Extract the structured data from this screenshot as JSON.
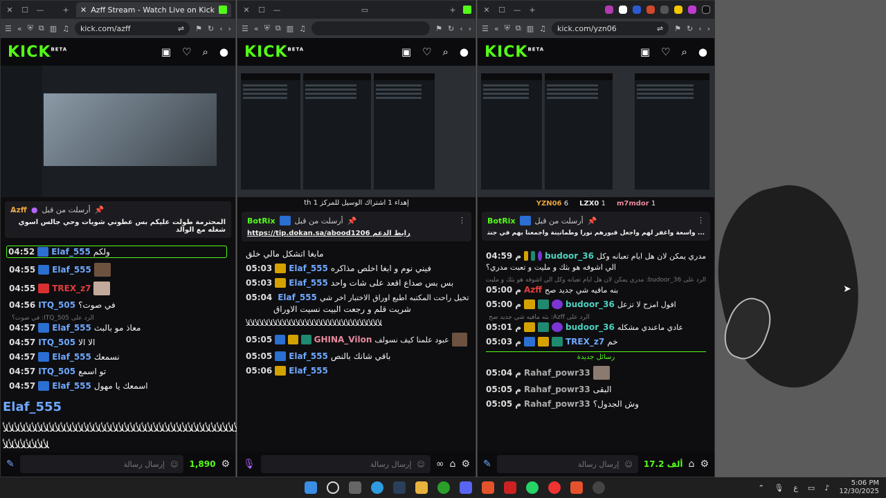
{
  "win1": {
    "tab_title": "Azff Stream - Watch Live on Kick",
    "url": "kick.com/azff",
    "pinned": {
      "from_label": "أرسلت من قبل",
      "from_user": "Azff",
      "message": "المحترمة طولت عليكم بس عطوني شويات وحي جالس اسوي شغله مع الوالد"
    },
    "chat": [
      {
        "time": "04:52",
        "user": "Elaf_555",
        "color": "#6fa8ff",
        "text": "ولكم"
      },
      {
        "time": "04:55",
        "user": "Elaf_555",
        "color": "#6fa8ff",
        "text": ""
      },
      {
        "time": "04:55",
        "user": "TREX_z7",
        "color": "#e63c3c",
        "text": ""
      },
      {
        "time": "04:56",
        "user": "ITQ_505",
        "color": "#6fa8ff",
        "text": "في صوت؟"
      },
      {
        "time": "04:57",
        "user": "Elaf_555",
        "color": "#6fa8ff",
        "text": "معاذ مو بالبث"
      },
      {
        "time": "04:57",
        "user": "ITQ_505",
        "color": "#6fa8ff",
        "text": "الا الا"
      },
      {
        "time": "04:57",
        "user": "Elaf_555",
        "color": "#6fa8ff",
        "text": "نسمعك"
      },
      {
        "time": "04:57",
        "user": "ITQ_505",
        "color": "#6fa8ff",
        "text": "تو اسمع"
      },
      {
        "time": "04:57",
        "user": "Elaf_555",
        "color": "#6fa8ff",
        "text": "اسمعك يا مهول"
      }
    ],
    "reply_1": "الرد على ITQ_505: في صوت؟",
    "overlay_name": "Elaf_555",
    "overlay_wave": "ﻸﻸﻸﻸﻸﻸﻸﻸﻸﻸﻸﻸﻸﻸﻸﻸﻸﻸﻸﻸﻸﻸﻸﻸﻸﻸﻸﻸﻸﻸﻸﻸﻸﻸﻸﻸﻸﻸﻸﻸﻸﻸﻸﻸﻸﻸ",
    "overlay_wave2": "ﻸﻸﻸﻸﻸﻸﻸﻸ",
    "input_placeholder": "إرسال رسالة",
    "points": "1,890"
  },
  "win2": {
    "url": "",
    "top_note": "إهداء 1 اشتراك الوسيل للمركز 1",
    "top_note_suffix": "th",
    "pinned": {
      "from_label": "أرسلت من قبل",
      "from_user": "BotRix",
      "message": "https://tip.dokan.sa/abood1206 رابط الدعم"
    },
    "chat": [
      {
        "time": "",
        "user": "",
        "color": "#6fa8ff",
        "text": "مابغا اتشكل مالي خلق"
      },
      {
        "time": "05:03",
        "user": "Elaf_555",
        "color": "#6fa8ff",
        "text": "فيني نوم و ابغا اخلص مذاكره"
      },
      {
        "time": "05:03",
        "user": "Elaf_555",
        "color": "#6fa8ff",
        "text": "بس بس صداع اقعد على شات واحد"
      },
      {
        "time": "05:04",
        "user": "Elaf_555",
        "color": "#6fa8ff",
        "text": "تخيل راحت المكتبه اطبع اوراق الاختبار اخر شي"
      },
      {
        "time": "05:05",
        "user": "Elaf_555",
        "color": "#6fa8ff",
        "text": "شريت قلم و رجعت البيت نسيت الاوراق"
      },
      {
        "time": "05:05",
        "user": "GHINA_Vilon",
        "color": "#e98aa0",
        "text": "عبود علمنا كيف نسولف"
      },
      {
        "time": "05:05",
        "user": "Elaf_555",
        "color": "#6fa8ff",
        "text": "باقي شانك بالنص"
      },
      {
        "time": "05:06",
        "user": "Elaf_555",
        "color": "#6fa8ff",
        "text": ""
      }
    ],
    "wave": "ﻸﻸﻸﻸﻸﻸﻸﻸﻸﻸﻸﻸﻸﻸﻸﻸﻸﻸﻸﻸﻸﻸﻸﻸﻸﻸﻸﻸﻸﻸ",
    "input_placeholder": "إرسال رسالة"
  },
  "win3": {
    "url": "kick.com/yzn06",
    "top_chatters": [
      {
        "name": "YZN06",
        "count": "6"
      },
      {
        "name": "LZX0",
        "count": "1"
      },
      {
        "name": "m7mdor",
        "count": "1"
      }
    ],
    "pinned": {
      "from_label": "أرسلت من قبل",
      "from_user": "BotRix",
      "message": "... واسعة واغفر لهم واجعل قبورهم نورا وطمأنينة واجمعنا بهم في جنتك بلا حساب ولا عقاب"
    },
    "chat": [
      {
        "time": "04:59",
        "user": "budoor_36",
        "color": "#4fd0c0",
        "text": "مدري يمكن لان هل ايام تعبانه وكل"
      },
      {
        "time": "",
        "user": "",
        "color": "#4fd0c0",
        "text": "الي اشوفه هو بثك و مليت و تعبت مدري؟"
      },
      {
        "time": "05:00",
        "user": "Azff",
        "color": "#e63c3c",
        "text": "بنه مافيه شي جديد صح"
      },
      {
        "time": "05:00",
        "user": "budoor_36",
        "color": "#4fd0c0",
        "text": "افول امزح لا تزعل"
      },
      {
        "time": "05:01",
        "user": "budoor_36",
        "color": "#4fd0c0",
        "text": "عادي ماعندي مشكله"
      },
      {
        "time": "05:03",
        "user": "TREX_z7",
        "color": "#6fa8ff",
        "text": "خم"
      }
    ],
    "reply_1": "الرد على budoor_36: مدري يمكن لان هل ايام تعبانه وكل الي اشوفه هو بثك و مليت و تعبت مدري؟",
    "reply_2": "الرد على Azff: بثه مافيه شي جديد صح",
    "new_messages": "رسائل جديدة",
    "chat_new": [
      {
        "time": "05:04",
        "user": "Rahaf_powr33",
        "color": "#aaaaaa",
        "text": ""
      },
      {
        "time": "05:05",
        "user": "Rahaf_powr33",
        "color": "#aaaaaa",
        "text": "البقى"
      },
      {
        "time": "05:05",
        "user": "Rahaf_powr33",
        "color": "#aaaaaa",
        "text": "وش الجدول؟"
      }
    ],
    "input_placeholder": "إرسال رسالة",
    "points": "17.2 ألف"
  },
  "pm_suffix": "م",
  "taskbar": {
    "time": "5:06 PM",
    "date": "12/30/2025",
    "lang": "ع"
  }
}
